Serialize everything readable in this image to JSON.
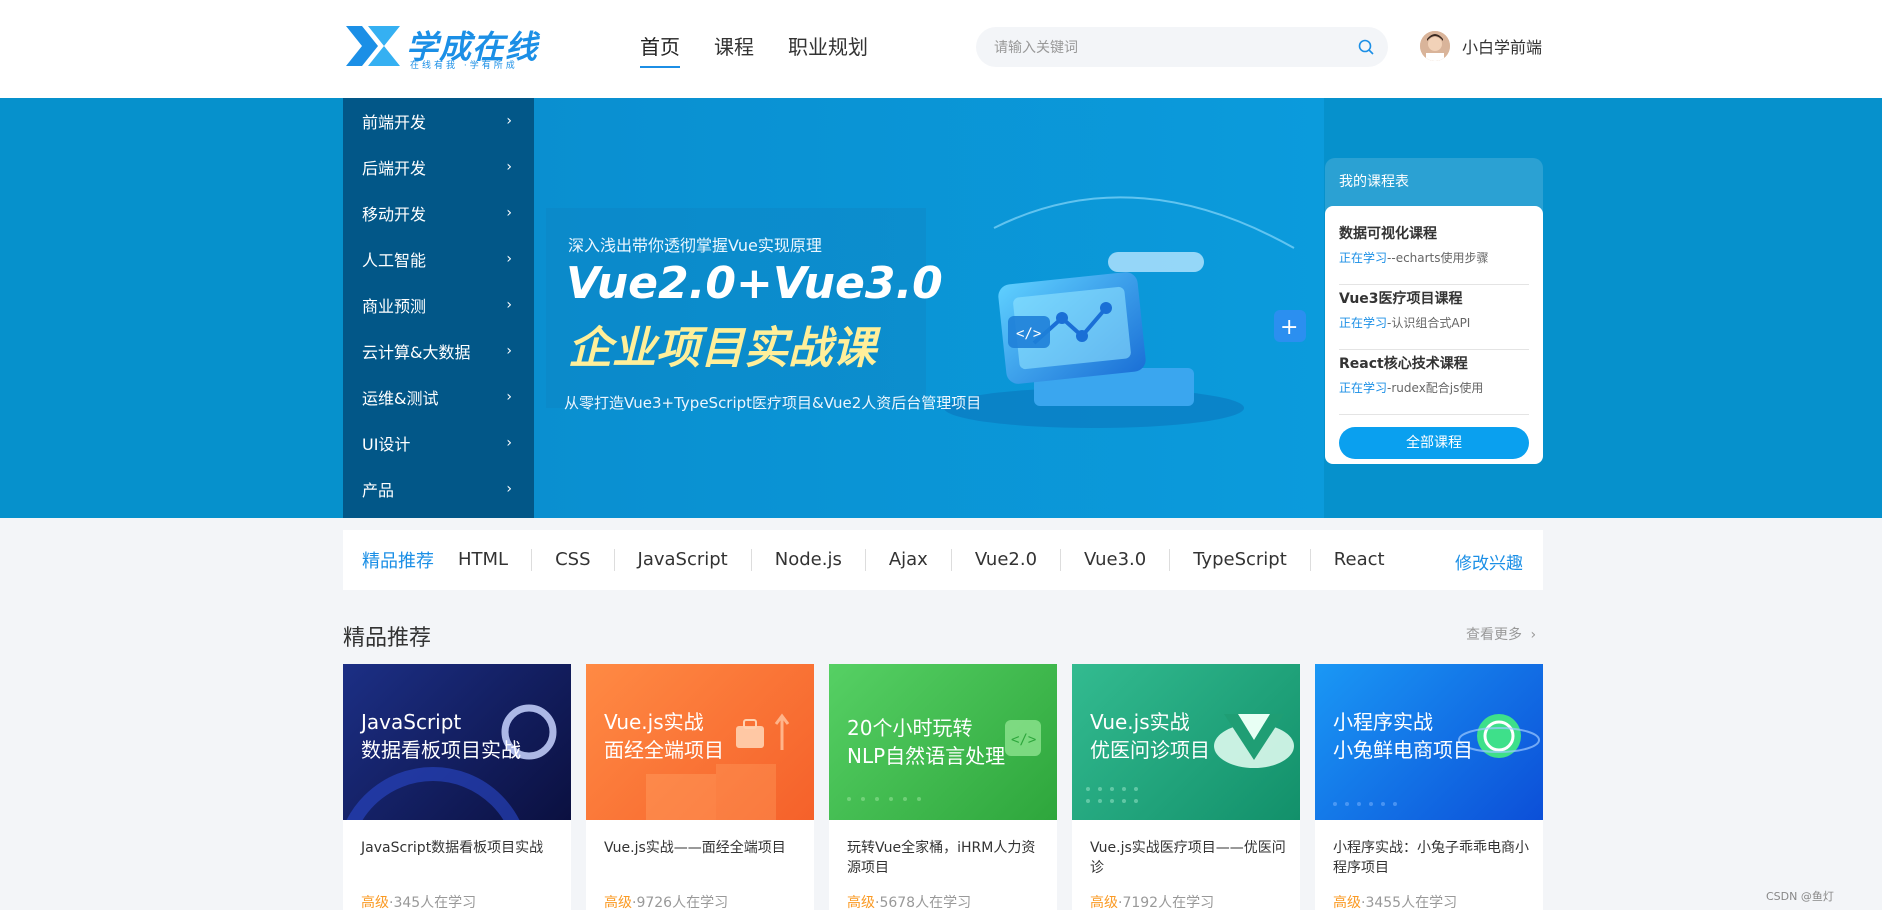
{
  "brand": {
    "name": "学成在线",
    "slogan": "在线有我 ·学有所成"
  },
  "nav": {
    "items": [
      "首页",
      "课程",
      "职业规划"
    ],
    "active": "首页"
  },
  "search": {
    "placeholder": "请输入关键词"
  },
  "user": {
    "name": "小白学前端"
  },
  "sidebar": {
    "items": [
      "前端开发",
      "后端开发",
      "移动开发",
      "人工智能",
      "商业预测",
      "云计算&大数据",
      "运维&测试",
      "UI设计",
      "产品"
    ]
  },
  "banner": {
    "subtitle": "深入浅出带你透彻掌握Vue实现原理",
    "title1": "Vue2.0+Vue3.0",
    "title2": "企业项目实战课",
    "desc": "从零打造Vue3+TypeScript医疗项目&Vue2人资后台管理项目"
  },
  "schedule": {
    "title": "我的课程表",
    "items": [
      {
        "name": "数据可视化课程",
        "status": "正在学习",
        "sep": "--",
        "detail": "echarts使用步骤"
      },
      {
        "name": "Vue3医疗项目课程",
        "status": "正在学习",
        "sep": "-",
        "detail": "认识组合式API"
      },
      {
        "name": "React核心技术课程",
        "status": "正在学习",
        "sep": "-",
        "detail": "rudex配合js使用"
      }
    ],
    "button": "全部课程"
  },
  "tags": {
    "title": "精品推荐",
    "items": [
      "HTML",
      "CSS",
      "JavaScript",
      "Node.js",
      "Ajax",
      "Vue2.0",
      "Vue3.0",
      "TypeScript",
      "React"
    ],
    "edit": "修改兴趣"
  },
  "section": {
    "title": "精品推荐",
    "more": "查看更多"
  },
  "courses": [
    {
      "cover": "JavaScript\n数据看板项目实战",
      "name": "JavaScript数据看板项目实战",
      "level": "高级",
      "learners": "·345人在学习",
      "color1": "#1a2a7a",
      "color2": "#0b1040"
    },
    {
      "cover": "Vue.js实战\n面经全端项目",
      "name": "Vue.js实战——面经全端项目",
      "level": "高级",
      "learners": "·9726人在学习",
      "color1": "#ff7a3c",
      "color2": "#f86a2a"
    },
    {
      "cover": "20个小时玩转\nNLP自然语言处理",
      "name": "玩转Vue全家桶，iHRM人力资源项目",
      "level": "高级",
      "learners": "·5678人在学习",
      "color1": "#4cc85a",
      "color2": "#2ea63c"
    },
    {
      "cover": "Vue.js实战\n优医问诊项目",
      "name": "Vue.js实战医疗项目——优医问诊",
      "level": "高级",
      "learners": "·7192人在学习",
      "color1": "#2db38a",
      "color2": "#12906a"
    },
    {
      "cover": "小程序实战\n小兔鲜电商项目",
      "name": "小程序实战：小兔子乖乖电商小程序项目",
      "level": "高级",
      "learners": "·3455人在学习",
      "color1": "#1a8ef2",
      "color2": "#0c5ad8"
    }
  ],
  "watermark": "CSDN @鱼灯"
}
